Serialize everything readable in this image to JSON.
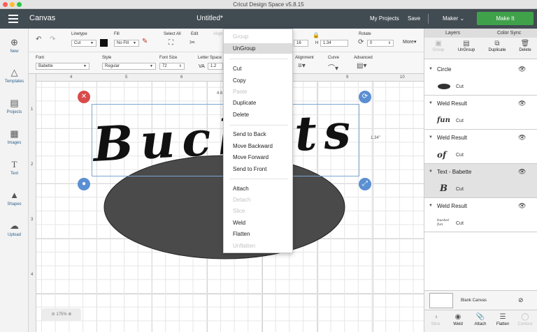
{
  "window": {
    "title": "Cricut Design Space  v5.8.15"
  },
  "topbar": {
    "app_name": "Canvas",
    "doc_title": "Untitled*",
    "my_projects": "My Projects",
    "save": "Save",
    "machine": "Maker",
    "make_it": "Make It"
  },
  "sidebar": {
    "items": [
      {
        "label": "New",
        "icon": "plus-circle-icon"
      },
      {
        "label": "Templates",
        "icon": "shirt-icon"
      },
      {
        "label": "Projects",
        "icon": "projects-icon"
      },
      {
        "label": "Images",
        "icon": "image-icon"
      },
      {
        "label": "Text",
        "icon": "text-icon"
      },
      {
        "label": "Shapes",
        "icon": "shapes-icon"
      },
      {
        "label": "Upload",
        "icon": "upload-cloud-icon"
      }
    ]
  },
  "edit_bar": {
    "linetype_label": "Linetype",
    "linetype_value": "Cut",
    "fill_label": "Fill",
    "fill_value": "No Fill",
    "select_all": "Select All",
    "edit": "Edit",
    "align": "Align",
    "size_w": "16",
    "size_h_label": "H",
    "size_h": "1.34",
    "rotate_label": "Rotate",
    "rotate_value": "0",
    "more": "More"
  },
  "text_bar": {
    "font_label": "Font",
    "font_value": "Babette",
    "style_label": "Style",
    "style_value": "Regular",
    "font_size_label": "Font Size",
    "font_size_value": "72",
    "letter_space_label": "Letter Space",
    "va": "VA",
    "letter_space_value": "1.2",
    "alignment": "Alignment",
    "curve": "Curve",
    "advanced": "Advanced"
  },
  "canvas": {
    "ruler_h": [
      "4",
      "5",
      "6",
      "7",
      "8",
      "9",
      "10"
    ],
    "ruler_v": [
      "1",
      "2",
      "3",
      "4"
    ],
    "width_label": "4.6",
    "height_label": "1.34\"",
    "zoom": "175%",
    "text": "Buckets",
    "ellipse_color": "#4a4a4a"
  },
  "context_menu": {
    "items": [
      {
        "label": "Group",
        "disabled": true
      },
      {
        "label": "UnGroup",
        "disabled": false,
        "highlighted": true
      },
      {
        "label": "Cut",
        "disabled": false
      },
      {
        "label": "Copy",
        "disabled": false
      },
      {
        "label": "Paste",
        "disabled": true
      },
      {
        "label": "Duplicate",
        "disabled": false
      },
      {
        "label": "Delete",
        "disabled": false
      },
      {
        "label": "Send to Back",
        "disabled": false
      },
      {
        "label": "Move Backward",
        "disabled": false
      },
      {
        "label": "Move Forward",
        "disabled": false
      },
      {
        "label": "Send to Front",
        "disabled": false
      },
      {
        "label": "Attach",
        "disabled": false
      },
      {
        "label": "Detach",
        "disabled": true
      },
      {
        "label": "Slice",
        "disabled": true
      },
      {
        "label": "Weld",
        "disabled": false
      },
      {
        "label": "Flatten",
        "disabled": false
      },
      {
        "label": "Unflatten",
        "disabled": true
      }
    ]
  },
  "panel": {
    "tab_layers": "Layers",
    "tab_color_sync": "Color Sync",
    "tools": [
      {
        "label": "Group",
        "icon": "group-icon",
        "disabled": true
      },
      {
        "label": "UnGroup",
        "icon": "ungroup-icon",
        "disabled": false
      },
      {
        "label": "Duplicate",
        "icon": "duplicate-icon",
        "disabled": false
      },
      {
        "label": "Delete",
        "icon": "trash-icon",
        "disabled": false
      }
    ],
    "layers": [
      {
        "title": "Circle",
        "op": "Cut",
        "thumb": "ellipse"
      },
      {
        "title": "Weld Result",
        "op": "Cut",
        "thumb": "fun"
      },
      {
        "title": "Weld Result",
        "op": "Cut",
        "thumb": "of"
      },
      {
        "title": "Text - Babette",
        "op": "Cut",
        "thumb": "B",
        "selected": true
      },
      {
        "title": "Weld Result",
        "op": "Cut",
        "thumb": "bucket"
      }
    ],
    "blank_canvas": "Blank Canvas",
    "bottom_tools": [
      {
        "label": "Slice",
        "icon": "slice-icon",
        "disabled": true
      },
      {
        "label": "Weld",
        "icon": "weld-icon",
        "disabled": false
      },
      {
        "label": "Attach",
        "icon": "attach-icon",
        "disabled": false
      },
      {
        "label": "Flatten",
        "icon": "flatten-icon",
        "disabled": false
      },
      {
        "label": "Contour",
        "icon": "contour-icon",
        "disabled": true
      }
    ]
  },
  "colors": {
    "topbar": "#414b52",
    "make_it": "#3fa24a",
    "delete_handle": "#d94b4b",
    "handle": "#5b8fd3"
  }
}
